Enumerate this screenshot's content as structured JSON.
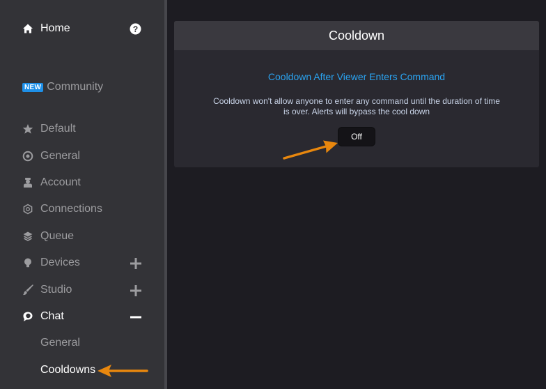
{
  "sidebar": {
    "home": {
      "label": "Home",
      "icon": "home-icon"
    },
    "help_icon": "question-circle-icon",
    "community": {
      "badge": "NEW",
      "label": "Community"
    },
    "items": [
      {
        "label": "Default",
        "icon": "star-icon"
      },
      {
        "label": "General",
        "icon": "target-icon"
      },
      {
        "label": "Account",
        "icon": "account-icon"
      },
      {
        "label": "Connections",
        "icon": "hexagon-icon"
      },
      {
        "label": "Queue",
        "icon": "layers-icon"
      },
      {
        "label": "Devices",
        "icon": "lightbulb-icon",
        "toggle": "plus"
      },
      {
        "label": "Studio",
        "icon": "brush-icon",
        "toggle": "plus"
      },
      {
        "label": "Chat",
        "icon": "chat-bubble-icon",
        "toggle": "minus",
        "active": true
      }
    ],
    "chat_sub_items": [
      {
        "label": "General"
      },
      {
        "label": "Cooldowns",
        "active": true
      }
    ]
  },
  "panel": {
    "title": "Cooldown",
    "setting_title": "Cooldown After Viewer Enters Command",
    "setting_description": "Cooldown won't allow anyone to enter any command until the duration of time is over. Alerts will bypass the cool down",
    "toggle_value": "Off"
  },
  "colors": {
    "accent_blue": "#2aa3f0",
    "annotation_arrow": "#e8870e",
    "sidebar_bg": "#333337",
    "main_bg": "#1d1c22"
  }
}
